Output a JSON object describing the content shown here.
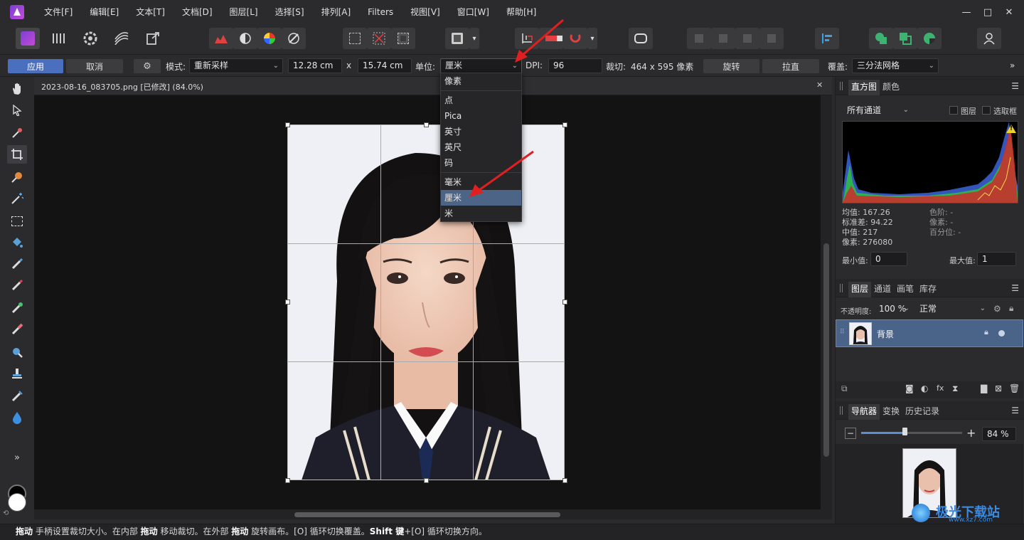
{
  "menu": {
    "items": [
      "文件[F]",
      "编辑[E]",
      "文本[T]",
      "文档[D]",
      "图层[L]",
      "选择[S]",
      "排列[A]",
      "Filters",
      "视图[V]",
      "窗口[W]",
      "帮助[H]"
    ],
    "win_min": "—",
    "win_max": "□",
    "win_close": "✕"
  },
  "toolbar": {
    "personas": [
      "photo-persona-icon",
      "liquify-persona-icon",
      "develop-persona-icon",
      "tone-mapping-persona-icon",
      "export-persona-icon"
    ],
    "more_symbol": "▾"
  },
  "context": {
    "apply": "应用",
    "cancel": "取消",
    "mode_label": "模式:",
    "mode_value": "重新采样",
    "width": "12.28 cm",
    "x": "x",
    "height": "15.74 cm",
    "unit_label": "单位:",
    "unit_value": "厘米",
    "dpi_label": "DPI:",
    "dpi_value": "96",
    "crop_label": "裁切:",
    "crop_value": "464 x 595 像素",
    "rotate": "旋转",
    "straighten": "拉直",
    "overlay_label": "覆盖:",
    "overlay_value": "三分法网格",
    "more": "»",
    "chev": "⌄"
  },
  "unit_dropdown": {
    "options": [
      "像素",
      "点",
      "Pica",
      "英寸",
      "英尺",
      "码",
      "毫米",
      "厘米",
      "米"
    ],
    "selected": "厘米"
  },
  "document": {
    "tab_title": "2023-08-16_083705.png [已修改] (84.0%)",
    "close": "✕"
  },
  "left_tools": {
    "more": "»"
  },
  "histogram": {
    "tab_histogram": "直方图",
    "tab_color": "颜色",
    "channel": "所有通道",
    "layer_check": "图层",
    "marquee_check": "选取框",
    "stats_left": [
      "均值: 167.26",
      "标准差: 94.22",
      "中值: 217",
      "像素: 276080"
    ],
    "stats_right": [
      "色阶: -",
      "像素: -",
      "百分位: -"
    ],
    "min_label": "最小值:",
    "min_value": "0",
    "max_label": "最大值:",
    "max_value": "1",
    "warning": "!"
  },
  "layers": {
    "tabs": [
      "图层",
      "通道",
      "画笔",
      "库存"
    ],
    "opacity_label": "不透明度:",
    "opacity_value": "100 %",
    "blend_value": "正常",
    "layer_name": "背景"
  },
  "navigator": {
    "tabs": [
      "导航器",
      "变换",
      "历史记录"
    ],
    "zoom_value": "84 %",
    "minus": "−",
    "plus": "+"
  },
  "status": {
    "b1": "拖动",
    "t1": " 手柄设置裁切大小。在内部 ",
    "b2": "拖动",
    "t2": " 移动裁切。在外部 ",
    "b3": "拖动",
    "t3": " 旋转画布。[O] 循环切换覆盖。",
    "b4": "Shift 键",
    "t4": "+[O] 循环切换方向。"
  },
  "watermark": {
    "text": "极光下载站",
    "url": "www.xz7.com"
  },
  "colors": {
    "accent": "#4a6fbe",
    "selection": "#4c6485",
    "arrow": "#e02020"
  }
}
